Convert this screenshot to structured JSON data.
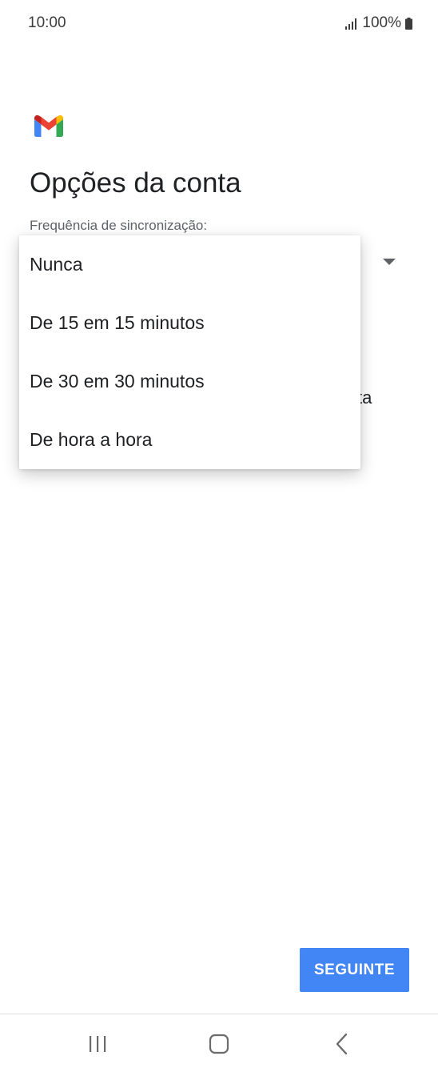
{
  "status_bar": {
    "time": "10:00",
    "battery_percent": "100%",
    "icons": [
      "signal-icon",
      "battery-icon"
    ]
  },
  "app": {
    "logo": "gmail-logo",
    "logo_colors": [
      "#4285f4",
      "#ea4335",
      "#fbbc05",
      "#34a853",
      "#c5221f"
    ]
  },
  "page": {
    "title": "Opções da conta",
    "sync_label": "Frequência de sincronização:",
    "partial_background_text": "ta"
  },
  "sync_menu": {
    "options": [
      {
        "label": "Nunca"
      },
      {
        "label": "De 15 em 15 minutos"
      },
      {
        "label": "De 30 em 30 minutos"
      },
      {
        "label": "De hora a hora"
      }
    ]
  },
  "actions": {
    "next_label": "SEGUINTE",
    "accent_color": "#4285f4"
  },
  "nav_bar": {
    "icons": [
      "recents-icon",
      "home-icon",
      "back-icon"
    ]
  }
}
